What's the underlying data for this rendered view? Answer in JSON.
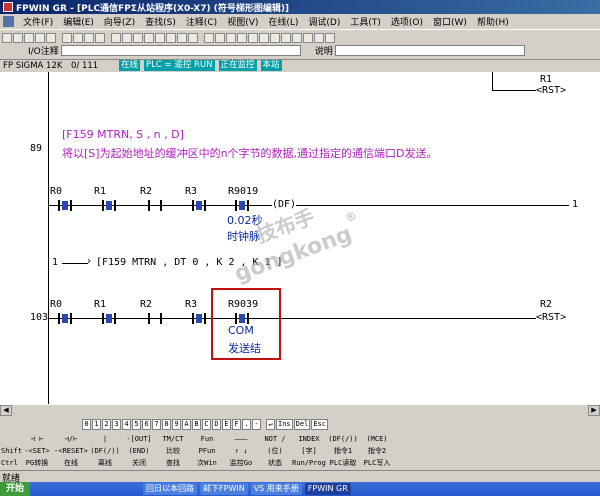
{
  "window": {
    "title": "FPWIN GR - [PLC通信FPΣ从站程序(X0-X7) (符号梯形图编辑)]"
  },
  "menu": [
    "文件(F)",
    "编辑(E)",
    "向导(Z)",
    "查找(S)",
    "注释(C)",
    "视图(V)",
    "在线(L)",
    "调试(D)",
    "工具(T)",
    "选项(O)",
    "窗口(W)",
    "帮助(H)"
  ],
  "comment_bar": {
    "io_label": "I/O注释",
    "desc_label": "说明"
  },
  "status_line": {
    "model": "FP SIGMA 12K",
    "step": "0/ 111",
    "online": "在线",
    "mode": "PLC = 遥控 RUN",
    "monitor": "正在监控",
    "station": "本站"
  },
  "ladder": {
    "top_coil_label": "R1",
    "top_coil": "<RST>",
    "step_89": "89",
    "comment_title": "[F159 MTRN, S , n , D]",
    "comment_desc": "将以[S]为起始地址的缓冲区中的n个字节的数据,通过指定的通信端口D发送。",
    "row1_contacts": [
      "R0",
      "R1",
      "R2",
      "R3",
      "R9019"
    ],
    "row1_df": "(DF)",
    "row1_end": "1",
    "note_9019_a": "0.02秒",
    "note_9019_b": "时钟脉",
    "row2_start": "1",
    "row2_instr": "[F159 MTRN    ,   DT 0     ,   K 2     ,   K 1      ]",
    "step_103": "103",
    "row3_contacts": [
      "R0",
      "R1",
      "R2",
      "R3",
      "R9039"
    ],
    "row3_coil_label": "R2",
    "row3_coil": "<RST>",
    "note_9039_a": "COM",
    "note_9039_b": "发送结"
  },
  "watermark": {
    "a": "技布手",
    "b": "gongkong",
    "r": "®"
  },
  "keybar": [
    "0",
    "1",
    "2",
    "3",
    "4",
    "5",
    "6",
    "7",
    "8",
    "9",
    "A",
    "B",
    "C",
    "D",
    "E",
    "F",
    ".",
    "-",
    "↵",
    "Ins",
    "Del",
    "Esc"
  ],
  "fkeys": {
    "row_labels": [
      "Shift",
      "Ctrl"
    ],
    "row1": [
      "⊣ ⊢",
      "⊣/⊢",
      "|",
      "-[OUT]",
      "TM/CT",
      "Fun",
      "———",
      "NOT /",
      "INDEX",
      "(DF(/))",
      "(MCE)"
    ],
    "row2": [
      "-<SET>",
      "-<RESET>",
      "(DF(/))",
      "(END)",
      "比较",
      "PFun",
      "↑ ↓",
      "(位)",
      "[字]",
      "指令1",
      "指令2"
    ],
    "row3": [
      "PG转换",
      "在线",
      "离线",
      "关闭",
      "查找",
      "次Win",
      "监控Go",
      "状态",
      "Run/Prog",
      "PLC读取",
      "PLC写入"
    ]
  },
  "statusbar": "就绪",
  "taskbar": {
    "start": "开始",
    "items": [
      "回日以本回路",
      "邮下FPWIN",
      "VS 用来手册",
      "FPWIN GR"
    ]
  }
}
